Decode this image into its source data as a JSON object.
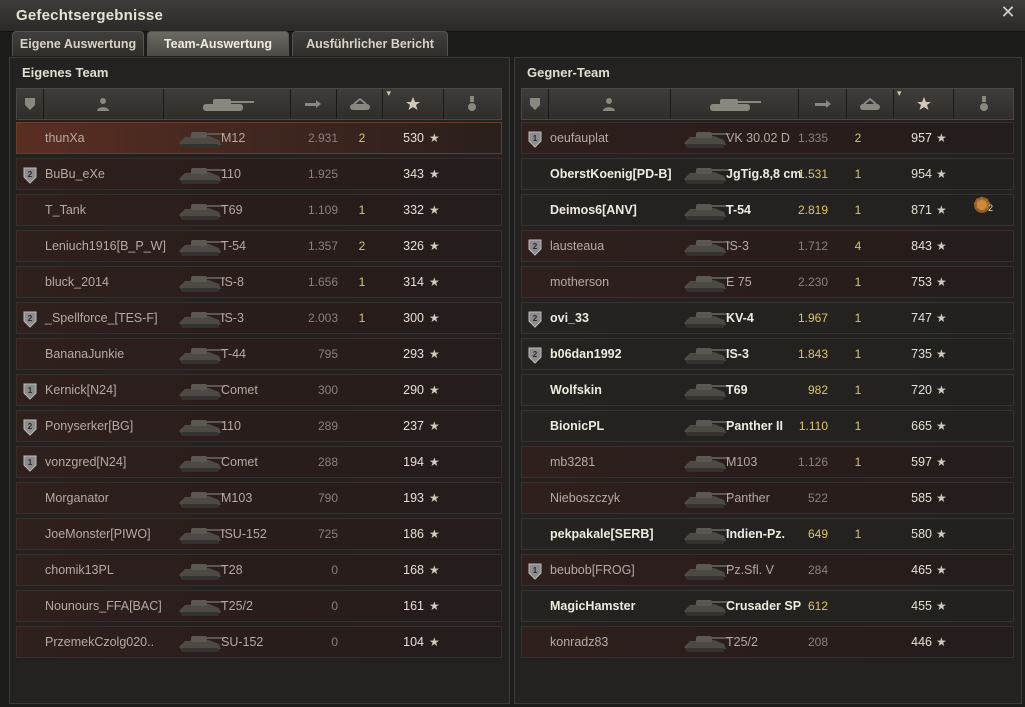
{
  "window": {
    "title": "Gefechtsergebnisse"
  },
  "tabs": [
    {
      "label": "Eigene Auswertung",
      "active": false
    },
    {
      "label": "Team-Auswertung",
      "active": true
    },
    {
      "label": "Ausführlicher Bericht",
      "active": false
    }
  ],
  "left_team": {
    "title": "Eigenes Team",
    "players": [
      {
        "name": "thunXa",
        "vehicle": "M12",
        "damage": "2.931",
        "kills": "2",
        "xp": "530",
        "badge": "",
        "status": "self"
      },
      {
        "name": "BuBu_eXe",
        "vehicle": "110",
        "damage": "1.925",
        "kills": "",
        "xp": "343",
        "badge": "2",
        "status": "destroyed"
      },
      {
        "name": "T_Tank",
        "vehicle": "T69",
        "damage": "1.109",
        "kills": "1",
        "xp": "332",
        "badge": "",
        "status": "destroyed"
      },
      {
        "name": "Leniuch1916[B_P_W]",
        "vehicle": "T-54",
        "damage": "1.357",
        "kills": "2",
        "xp": "326",
        "badge": "",
        "status": "destroyed"
      },
      {
        "name": "bluck_2014",
        "vehicle": "IS-8",
        "damage": "1.656",
        "kills": "1",
        "xp": "314",
        "badge": "",
        "status": "destroyed"
      },
      {
        "name": "_Spellforce_[TES-F]",
        "vehicle": "IS-3",
        "damage": "2.003",
        "kills": "1",
        "xp": "300",
        "badge": "2",
        "status": "destroyed"
      },
      {
        "name": "BananaJunkie",
        "vehicle": "T-44",
        "damage": "795",
        "kills": "",
        "xp": "293",
        "badge": "",
        "status": "destroyed"
      },
      {
        "name": "Kernick[N24]",
        "vehicle": "Comet",
        "damage": "300",
        "kills": "",
        "xp": "290",
        "badge": "1",
        "status": "destroyed"
      },
      {
        "name": "Ponyserker[BG]",
        "vehicle": "110",
        "damage": "289",
        "kills": "",
        "xp": "237",
        "badge": "2",
        "status": "destroyed"
      },
      {
        "name": "vonzgred[N24]",
        "vehicle": "Comet",
        "damage": "288",
        "kills": "",
        "xp": "194",
        "badge": "1",
        "status": "destroyed"
      },
      {
        "name": "Morganator",
        "vehicle": "M103",
        "damage": "790",
        "kills": "",
        "xp": "193",
        "badge": "",
        "status": "destroyed"
      },
      {
        "name": "JoeMonster[PIWO]",
        "vehicle": "ISU-152",
        "damage": "725",
        "kills": "",
        "xp": "186",
        "badge": "",
        "status": "destroyed"
      },
      {
        "name": "chomik13PL",
        "vehicle": "T28",
        "damage": "0",
        "kills": "",
        "xp": "168",
        "badge": "",
        "status": "destroyed"
      },
      {
        "name": "Nounours_FFA[BAC]",
        "vehicle": "T25/2",
        "damage": "0",
        "kills": "",
        "xp": "161",
        "badge": "",
        "status": "destroyed"
      },
      {
        "name": "PrzemekCzolg020..",
        "vehicle": "SU-152",
        "damage": "0",
        "kills": "",
        "xp": "104",
        "badge": "",
        "status": "destroyed"
      }
    ]
  },
  "right_team": {
    "title": "Gegner-Team",
    "players": [
      {
        "name": "oeufauplat",
        "vehicle": "VK 30.02 D",
        "damage": "1.335",
        "kills": "2",
        "xp": "957",
        "badge": "1",
        "status": "destroyed"
      },
      {
        "name": "OberstKoenig[PD-B]",
        "vehicle": "JgTig.8,8 cm",
        "damage": "1.531",
        "kills": "1",
        "xp": "954",
        "badge": "",
        "status": "alive"
      },
      {
        "name": "Deimos6[ANV]",
        "vehicle": "T-54",
        "damage": "2.819",
        "kills": "1",
        "xp": "871",
        "badge": "",
        "status": "alive",
        "medal": "2"
      },
      {
        "name": "lausteaua",
        "vehicle": "IS-3",
        "damage": "1.712",
        "kills": "4",
        "xp": "843",
        "badge": "2",
        "status": "destroyed"
      },
      {
        "name": "motherson",
        "vehicle": "E 75",
        "damage": "2.230",
        "kills": "1",
        "xp": "753",
        "badge": "",
        "status": "destroyed"
      },
      {
        "name": "ovi_33",
        "vehicle": "KV-4",
        "damage": "1.967",
        "kills": "1",
        "xp": "747",
        "badge": "2",
        "status": "alive"
      },
      {
        "name": "b06dan1992",
        "vehicle": "IS-3",
        "damage": "1.843",
        "kills": "1",
        "xp": "735",
        "badge": "2",
        "status": "alive"
      },
      {
        "name": "Wolfskin",
        "vehicle": "T69",
        "damage": "982",
        "kills": "1",
        "xp": "720",
        "badge": "",
        "status": "alive"
      },
      {
        "name": "BionicPL",
        "vehicle": "Panther II",
        "damage": "1.110",
        "kills": "1",
        "xp": "665",
        "badge": "",
        "status": "alive"
      },
      {
        "name": "mb3281",
        "vehicle": "M103",
        "damage": "1.126",
        "kills": "1",
        "xp": "597",
        "badge": "",
        "status": "destroyed"
      },
      {
        "name": "Nieboszczyk",
        "vehicle": "Panther",
        "damage": "522",
        "kills": "",
        "xp": "585",
        "badge": "",
        "status": "destroyed"
      },
      {
        "name": "pekpakale[SERB]",
        "vehicle": "Indien-Pz.",
        "damage": "649",
        "kills": "1",
        "xp": "580",
        "badge": "",
        "status": "alive"
      },
      {
        "name": "beubob[FROG]",
        "vehicle": "Pz.Sfl. V",
        "damage": "284",
        "kills": "",
        "xp": "465",
        "badge": "1",
        "status": "destroyed"
      },
      {
        "name": "MagicHamster",
        "vehicle": "Crusader SP",
        "damage": "612",
        "kills": "",
        "xp": "455",
        "badge": "",
        "status": "alive"
      },
      {
        "name": "konradz83",
        "vehicle": "T25/2",
        "damage": "208",
        "kills": "",
        "xp": "446",
        "badge": "",
        "status": "destroyed"
      }
    ]
  },
  "columns": [
    {
      "id": "badge",
      "icon": "shield-icon"
    },
    {
      "id": "player",
      "icon": "person-icon"
    },
    {
      "id": "vehicle",
      "icon": "tank-icon"
    },
    {
      "id": "damage",
      "icon": "damage-icon"
    },
    {
      "id": "kills",
      "icon": "destroyed-tanks-icon"
    },
    {
      "id": "xp",
      "icon": "star-icon",
      "sorted": true
    },
    {
      "id": "medals",
      "icon": "medal-icon"
    }
  ],
  "colors": {
    "accent": "#d9c27a",
    "self_row": "#5a2f22",
    "destroyed_row": "#2a1d1b",
    "alive_row": "#252320"
  },
  "star_glyph": "★",
  "close_glyph": "✕"
}
